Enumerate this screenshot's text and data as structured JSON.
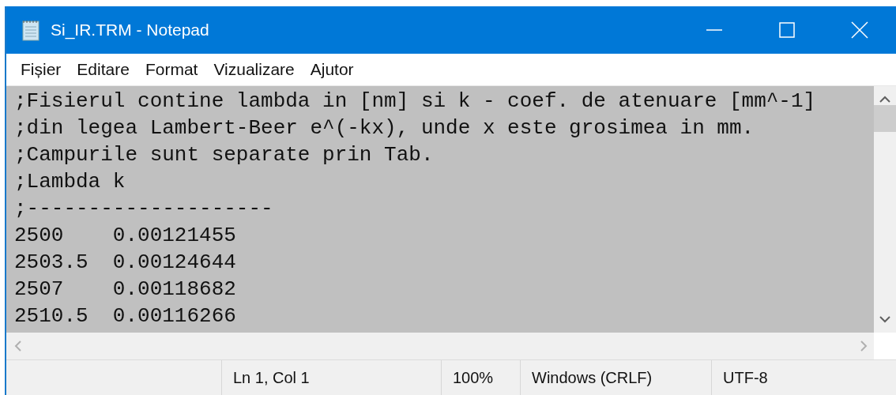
{
  "window": {
    "title": "Si_IR.TRM - Notepad"
  },
  "menu": [
    {
      "label": "Fișier"
    },
    {
      "label": "Editare"
    },
    {
      "label": "Format"
    },
    {
      "label": "Vizualizare"
    },
    {
      "label": "Ajutor"
    }
  ],
  "editor": {
    "selected": true,
    "lines": [
      ";Fisierul contine lambda in [nm] si k - coef. de atenuare [mm^-1]",
      ";din legea Lambert-Beer e^(-kx), unde x este grosimea in mm.",
      ";Campurile sunt separate prin Tab.",
      ";Lambda k",
      ";--------------------",
      "2500    0.00121455",
      "2503.5  0.00124644",
      "2507    0.00118682",
      "2510.5  0.00116266"
    ]
  },
  "status_bar": [
    "Ln 1, Col 1",
    "100%",
    "Windows (CRLF)",
    "UTF-8"
  ]
}
